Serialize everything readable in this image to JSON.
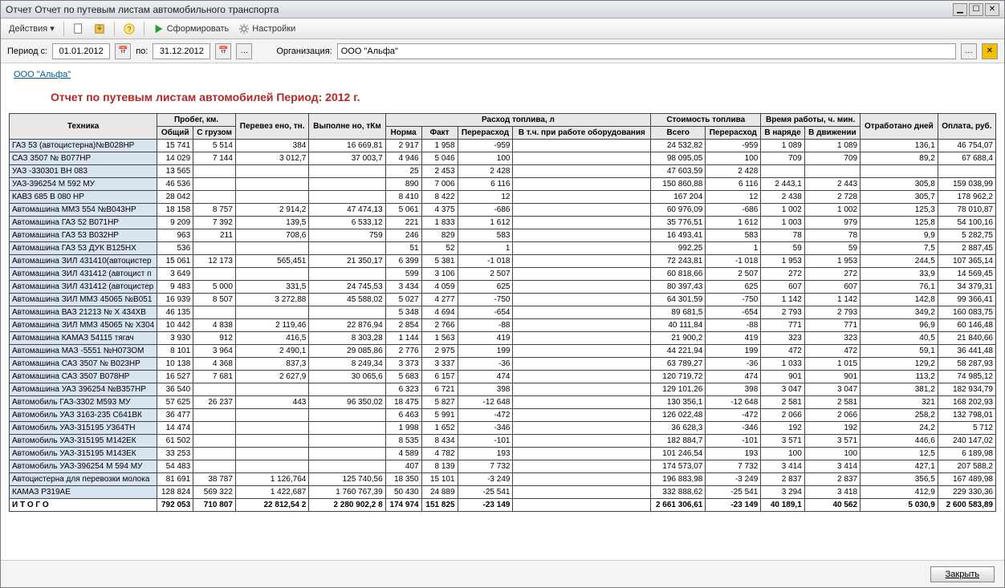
{
  "window_title": "Отчет  Отчет по путевым листам автомобильного транспорта",
  "toolbar": {
    "actions": "Действия",
    "run": "Сформировать",
    "settings": "Настройки"
  },
  "period": {
    "label_from": "Период с:",
    "from": "01.01.2012",
    "label_to": "по:",
    "to": "31.12.2012",
    "org_label": "Организация:",
    "org": "ООО \"Альфа\""
  },
  "org_link": "ООО \"Альфа\"",
  "report_title": "Отчет по путевым листам автомобилей  Период: 2012 г.",
  "headers": {
    "tech": "Техника",
    "probeg": "Пробег, км.",
    "probeg_total": "Общий",
    "probeg_cargo": "С грузом",
    "perevezeno": "Перевез\nено, тн.",
    "vypolneno": "Выполне\nно, тКм",
    "rashod": "Расход топлива, л",
    "norma": "Норма",
    "fact": "Факт",
    "pererashod": "Перерасход",
    "vtch": "В т.ч. при работе оборудования",
    "stoim": "Стоимость топлива",
    "vsego": "Всего",
    "pererashod2": "Перерасход",
    "vremya": "Время работы, ч. мин.",
    "vnaryade": "В наряде",
    "vdvizh": "В движении",
    "otrabotano": "Отработано\nдней",
    "oplata": "Оплата, руб."
  },
  "rows": [
    {
      "n": "ГАЗ 53 (автоцистерна)№В028НР",
      "c": [
        "15 741",
        "5 514",
        "384",
        "16 669,81",
        "2 917",
        "1 958",
        "-959",
        "",
        "24 532,82",
        "-959",
        "1 089",
        "1 089",
        "136,1",
        "46 754,07"
      ]
    },
    {
      "n": "САЗ 3507  № В077НР",
      "c": [
        "14 029",
        "7 144",
        "3 012,7",
        "37 003,7",
        "4 946",
        "5 046",
        "100",
        "",
        "98 095,05",
        "100",
        "709",
        "709",
        "89,2",
        "67 688,4"
      ]
    },
    {
      "n": "УАЗ -330301 ВН 083",
      "c": [
        "13 565",
        "",
        "",
        "",
        "25",
        "2 453",
        "2 428",
        "",
        "47 603,59",
        "2 428",
        "",
        "",
        "",
        ""
      ]
    },
    {
      "n": "УАЗ-396254  М 592 МУ",
      "c": [
        "46 536",
        "",
        "",
        "",
        "890",
        "7 006",
        "6 116",
        "",
        "150 860,88",
        "6 116",
        "2 443,1",
        "2 443",
        "305,8",
        "159 038,99"
      ]
    },
    {
      "n": "КАВЗ 685  В 080 НР",
      "c": [
        "28 042",
        "",
        "",
        "",
        "8 410",
        "8 422",
        "12",
        "",
        "167 204",
        "12",
        "2 438",
        "2 728",
        "305,7",
        "178 962,2"
      ]
    },
    {
      "n": "Автомашина   ММЗ 554  №В043НР",
      "c": [
        "18 158",
        "8 757",
        "2 914,2",
        "47 474,13",
        "5 061",
        "4 375",
        "-686",
        "",
        "60 976,09",
        "-686",
        "1 002",
        "1 002",
        "125,3",
        "78 010,87"
      ]
    },
    {
      "n": "Автомашина  ГАЗ 52  В071НР",
      "c": [
        "9 209",
        "7 392",
        "139,5",
        "6 533,12",
        "221",
        "1 833",
        "1 612",
        "",
        "35 776,51",
        "1 612",
        "1 003",
        "979",
        "125,8",
        "54 100,16"
      ]
    },
    {
      "n": "Автомашина  ГАЗ 53  В032НР",
      "c": [
        "963",
        "211",
        "708,6",
        "759",
        "246",
        "829",
        "583",
        "",
        "16 493,41",
        "583",
        "78",
        "78",
        "9,9",
        "5 282,75"
      ]
    },
    {
      "n": "Автомашина  ГАЗ 53  ДУК  В125НХ",
      "c": [
        "536",
        "",
        "",
        "",
        "51",
        "52",
        "1",
        "",
        "992,25",
        "1",
        "59",
        "59",
        "7,5",
        "2 887,45"
      ]
    },
    {
      "n": "Автомашина  ЗИЛ 431410(автоцистер",
      "c": [
        "15 061",
        "12 173",
        "565,451",
        "21 350,17",
        "6 399",
        "5 381",
        "-1 018",
        "",
        "72 243,81",
        "-1 018",
        "1 953",
        "1 953",
        "244,5",
        "107 365,14"
      ]
    },
    {
      "n": "Автомашина  ЗИЛ 431412 (автоцист п",
      "c": [
        "3 649",
        "",
        "",
        "",
        "599",
        "3 106",
        "2 507",
        "",
        "60 818,66",
        "2 507",
        "272",
        "272",
        "33,9",
        "14 569,45"
      ]
    },
    {
      "n": "Автомашина  ЗИЛ 431412 (автоцистер",
      "c": [
        "9 483",
        "5 000",
        "331,5",
        "24 745,53",
        "3 434",
        "4 059",
        "625",
        "",
        "80 397,43",
        "625",
        "607",
        "607",
        "76,1",
        "34 379,31"
      ]
    },
    {
      "n": "Автомашина  ЗИЛ ММЗ 45065 №В051",
      "c": [
        "16 939",
        "8 507",
        "3 272,88",
        "45 588,02",
        "5 027",
        "4 277",
        "-750",
        "",
        "64 301,59",
        "-750",
        "1 142",
        "1 142",
        "142,8",
        "99 366,41"
      ]
    },
    {
      "n": "Автомашина ВАЗ 21213 № Х 434ХВ",
      "c": [
        "46 135",
        "",
        "",
        "",
        "5 348",
        "4 694",
        "-654",
        "",
        "89 681,5",
        "-654",
        "2 793",
        "2 793",
        "349,2",
        "160 083,75"
      ]
    },
    {
      "n": "Автомашина ЗИЛ ММЗ 45065  № Х304",
      "c": [
        "10 442",
        "4 838",
        "2 119,46",
        "22 876,94",
        "2 854",
        "2 766",
        "-88",
        "",
        "40 111,84",
        "-88",
        "771",
        "771",
        "96,9",
        "60 146,48"
      ]
    },
    {
      "n": "Автомашина КАМАЗ 54115 тягач",
      "c": [
        "3 930",
        "912",
        "416,5",
        "8 303,28",
        "1 144",
        "1 563",
        "419",
        "",
        "21 900,2",
        "419",
        "323",
        "323",
        "40,5",
        "21 840,66"
      ]
    },
    {
      "n": "Автомашина МАЗ -5551  №Н073ОМ",
      "c": [
        "8 101",
        "3 964",
        "2 490,1",
        "29 085,86",
        "2 776",
        "2 975",
        "199",
        "",
        "44 221,94",
        "199",
        "472",
        "472",
        "59,1",
        "36 441,48"
      ]
    },
    {
      "n": "Автомашина САЗ 3507 № В023НР",
      "c": [
        "10 138",
        "4 368",
        "837,3",
        "8 249,34",
        "3 373",
        "3 337",
        "-36",
        "",
        "63 789,27",
        "-36",
        "1 033",
        "1 015",
        "129,2",
        "58 287,93"
      ]
    },
    {
      "n": "Автомашина САЗ 3507 В078НР",
      "c": [
        "16 527",
        "7 681",
        "2 627,9",
        "30 065,6",
        "5 683",
        "6 157",
        "474",
        "",
        "120 719,72",
        "474",
        "901",
        "901",
        "113,2",
        "74 985,12"
      ]
    },
    {
      "n": "Автомашина УАЗ 396254 №В357НР",
      "c": [
        "36 540",
        "",
        "",
        "",
        "6 323",
        "6 721",
        "398",
        "",
        "129 101,26",
        "398",
        "3 047",
        "3 047",
        "381,2",
        "182 934,79"
      ]
    },
    {
      "n": "Автомобиль ГАЗ-3302  М593 МУ",
      "c": [
        "57 625",
        "26 237",
        "443",
        "96 350,02",
        "18 475",
        "5 827",
        "-12 648",
        "",
        "130 356,1",
        "-12 648",
        "2 581",
        "2 581",
        "321",
        "168 202,93"
      ]
    },
    {
      "n": "Автомобиль УАЗ 3163-235 С641ВК",
      "c": [
        "36 477",
        "",
        "",
        "",
        "6 463",
        "5 991",
        "-472",
        "",
        "126 022,48",
        "-472",
        "2 066",
        "2 066",
        "258,2",
        "132 798,01"
      ]
    },
    {
      "n": "Автомобиль УАЗ-315195  У364ТН",
      "c": [
        "14 474",
        "",
        "",
        "",
        "1 998",
        "1 652",
        "-346",
        "",
        "36 628,3",
        "-346",
        "192",
        "192",
        "24,2",
        "5 712"
      ]
    },
    {
      "n": "Автомобиль УАЗ-315195 М142ЕК",
      "c": [
        "61 502",
        "",
        "",
        "",
        "8 535",
        "8 434",
        "-101",
        "",
        "182 884,7",
        "-101",
        "3 571",
        "3 571",
        "446,6",
        "240 147,02"
      ]
    },
    {
      "n": "Автомобиль УАЗ-315195 М143ЕК",
      "c": [
        "33 253",
        "",
        "",
        "",
        "4 589",
        "4 782",
        "193",
        "",
        "101 246,54",
        "193",
        "100",
        "100",
        "12,5",
        "6 189,98"
      ]
    },
    {
      "n": "Автомобиль УАЗ-396254  М 594 МУ",
      "c": [
        "54 483",
        "",
        "",
        "",
        "407",
        "8 139",
        "7 732",
        "",
        "174 573,07",
        "7 732",
        "3 414",
        "3 414",
        "427,1",
        "207 588,2"
      ]
    },
    {
      "n": "Автоцистерна для перевозки  молока",
      "c": [
        "81 691",
        "38 787",
        "1 126,764",
        "125 740,56",
        "18 350",
        "15 101",
        "-3 249",
        "",
        "196 883,98",
        "-3 249",
        "2 837",
        "2 837",
        "356,5",
        "167 489,98"
      ]
    },
    {
      "n": "КАМАЗ  Р319АЕ",
      "c": [
        "128 824",
        "569 322",
        "1 422,687",
        "1 760 767,39",
        "50 430",
        "24 889",
        "-25 541",
        "",
        "332 888,62",
        "-25 541",
        "3 294",
        "3 418",
        "412,9",
        "229 330,36"
      ]
    }
  ],
  "total": {
    "label": "И Т О Г О",
    "c": [
      "792 053",
      "710 807",
      "22 812,54\n2",
      "2 280 902,2\n8",
      "174 974",
      "151 825",
      "-23 149",
      "",
      "2 661 306,61",
      "-23 149",
      "40 189,1",
      "40 562",
      "5 030,9",
      "2 600 583,89"
    ]
  },
  "footer": {
    "close": "Закрыть"
  }
}
